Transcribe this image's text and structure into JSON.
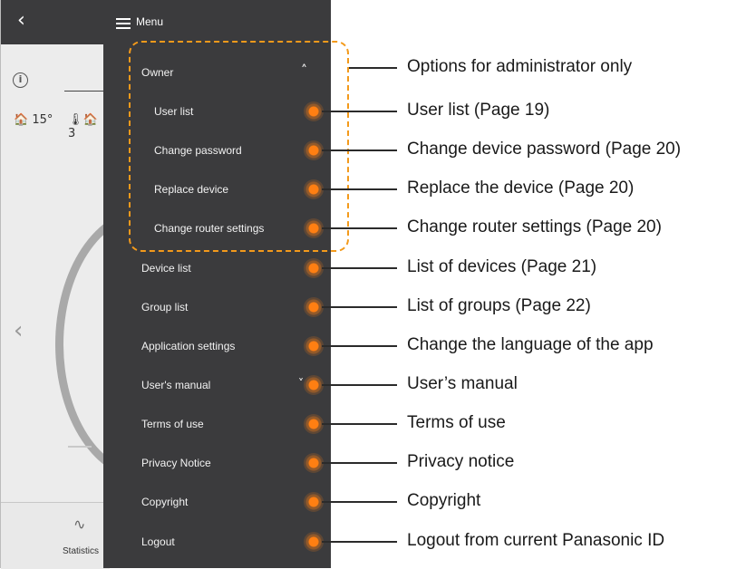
{
  "background": {
    "back_icon": "chevron-left",
    "info_icon": "i",
    "temp_indoor": "🏠 15°",
    "temp_outdoor": "🌡🏠 3",
    "prev_icon": "chevron-left",
    "stats_label": "Statistics"
  },
  "menu": {
    "title": "Menu",
    "owner": {
      "label": "Owner"
    },
    "owner_items": [
      {
        "label": "User list"
      },
      {
        "label": "Change password"
      },
      {
        "label": "Replace device"
      },
      {
        "label": "Change router settings"
      }
    ],
    "items": [
      {
        "label": "Device list"
      },
      {
        "label": "Group list"
      },
      {
        "label": "Application settings"
      },
      {
        "label": "User's manual"
      },
      {
        "label": "Terms of use"
      },
      {
        "label": "Privacy Notice"
      },
      {
        "label": "Copyright"
      },
      {
        "label": "Logout"
      }
    ]
  },
  "callouts": [
    "Options for administrator only",
    "User list (Page 19)",
    "Change device password (Page 20)",
    "Replace the device (Page 20)",
    "Change router settings (Page 20)",
    "List of devices (Page 21)",
    "List of groups (Page 22)",
    "Change the language of the app",
    "User’s manual",
    "Terms of use",
    "Privacy notice",
    "Copyright",
    "Logout from current Panasonic ID"
  ],
  "colors": {
    "accent": "#ff7f12",
    "dash": "#f39a1b",
    "panel": "#3b3b3d"
  }
}
